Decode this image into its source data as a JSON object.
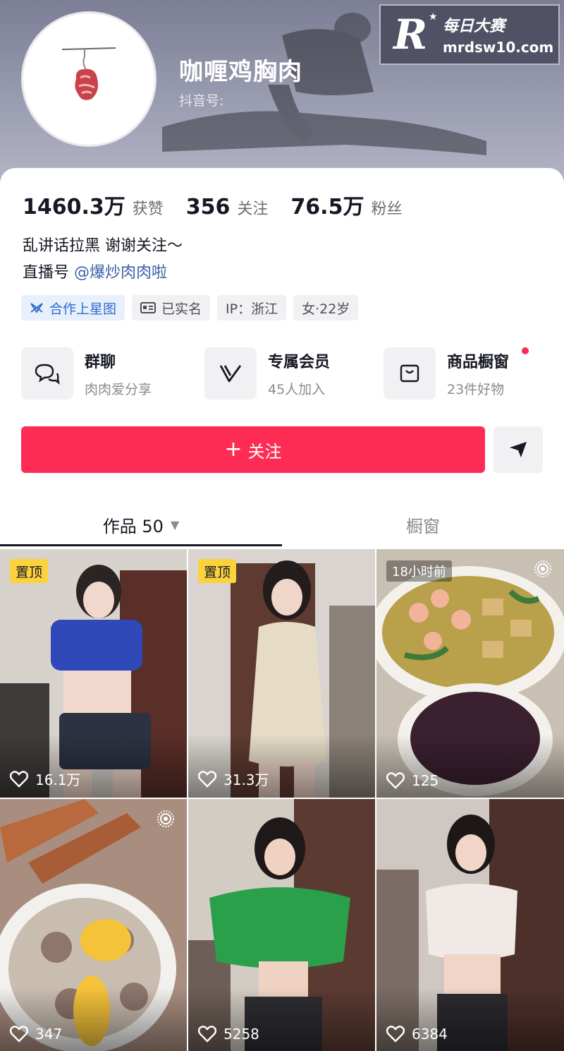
{
  "profile": {
    "nickname": "咖喱鸡胸肉",
    "douyin_id_label": "抖音号:"
  },
  "watermark": {
    "letter": "R",
    "line1": "每日大赛",
    "line2": "mrdsw10.com"
  },
  "stats": [
    {
      "value": "1460.3万",
      "label": "获赞"
    },
    {
      "value": "356",
      "label": "关注"
    },
    {
      "value": "76.5万",
      "label": "粉丝"
    }
  ],
  "bio": {
    "line1": "乱讲话拉黑 谢谢关注～",
    "line2_prefix": "直播号",
    "line2_link": "@爆炒肉肉啦"
  },
  "tags": [
    {
      "icon": "star-map-icon",
      "label": "合作上星图"
    },
    {
      "icon": "id-card-icon",
      "label": "已实名"
    },
    {
      "icon": "",
      "label": "IP：浙江"
    },
    {
      "icon": "",
      "label": "女·22岁"
    }
  ],
  "features": [
    {
      "icon": "group-chat-icon",
      "title": "群聊",
      "subtitle": "肉肉爱分享"
    },
    {
      "icon": "member-icon",
      "title": "专属会员",
      "subtitle": "45人加入"
    },
    {
      "icon": "shopping-bag-icon",
      "title": "商品橱窗",
      "subtitle": "23件好物",
      "has_dot": true
    }
  ],
  "actions": {
    "follow_label": "关注"
  },
  "tabs": [
    {
      "label": "作品 50",
      "active": true
    },
    {
      "label": "橱窗",
      "active": false
    }
  ],
  "videos": [
    {
      "badge": "置顶",
      "likes": "16.1万"
    },
    {
      "badge": "置顶",
      "likes": "31.3万"
    },
    {
      "badge": "18小时前",
      "likes": "125",
      "live": true
    },
    {
      "badge": "",
      "likes": "347",
      "live": true
    },
    {
      "badge": "",
      "likes": "5258"
    },
    {
      "badge": "",
      "likes": "6384"
    }
  ],
  "colors": {
    "accent": "#fe2c55",
    "link": "#3a5ea8",
    "pin": "#fbd23b"
  }
}
